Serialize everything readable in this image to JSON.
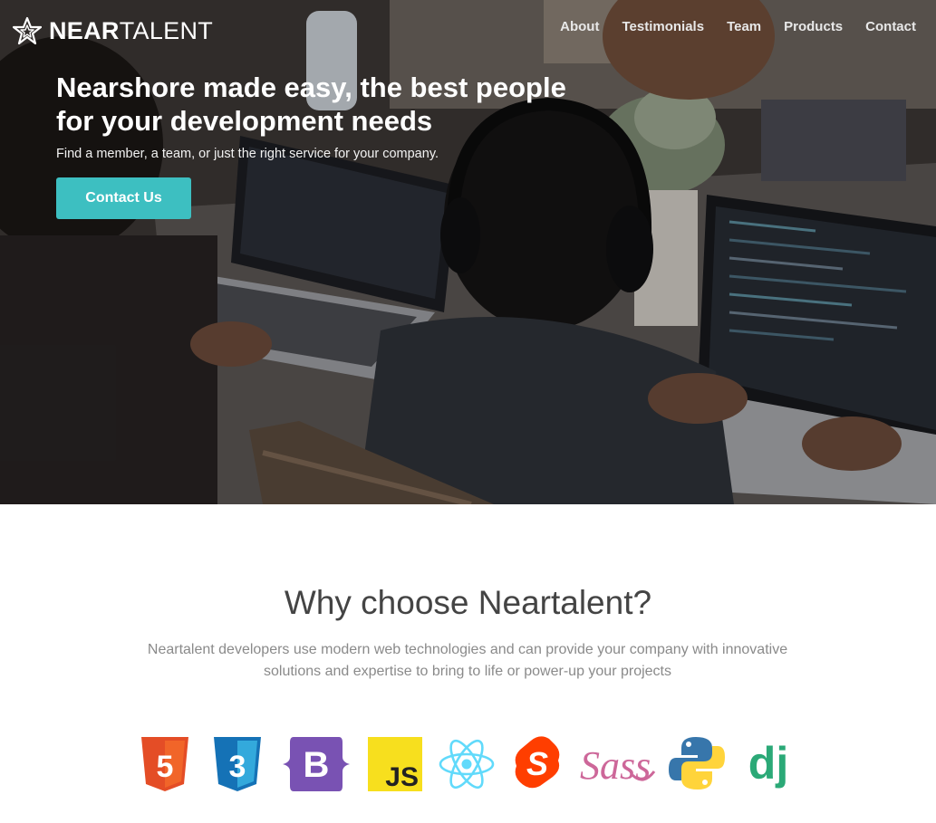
{
  "brand": {
    "name_bold": "NEAR",
    "name_light": "TALENT"
  },
  "nav": {
    "items": [
      "About",
      "Testimonials",
      "Team",
      "Products",
      "Contact"
    ]
  },
  "hero": {
    "title_line1": "Nearshore made easy, the best people",
    "title_line2": "for your development needs",
    "subtitle": "Find a member, a team, or just the right service for your company.",
    "cta_label": "Contact Us"
  },
  "why": {
    "title": "Why choose Neartalent?",
    "desc_line1": "Neartalent developers use modern web technologies and can provide your company with innovative",
    "desc_line2": "solutions and expertise to bring to life or power-up your projects"
  },
  "tech": {
    "html5": "5",
    "css3": "3",
    "bootstrap": "B",
    "js": "JS",
    "svelte": "S",
    "sass": "Sass",
    "django": "dj"
  },
  "colors": {
    "accent": "#3dbfc1",
    "html5": "#e44d26",
    "css3": "#1572b6",
    "bootstrap": "#7952b3",
    "js": "#f7df1e",
    "react": "#61dafb",
    "svelte": "#ff3e00",
    "sass": "#cd6799",
    "python_blue": "#3776ab",
    "python_yellow": "#ffd43b",
    "django": "#2ba977"
  }
}
